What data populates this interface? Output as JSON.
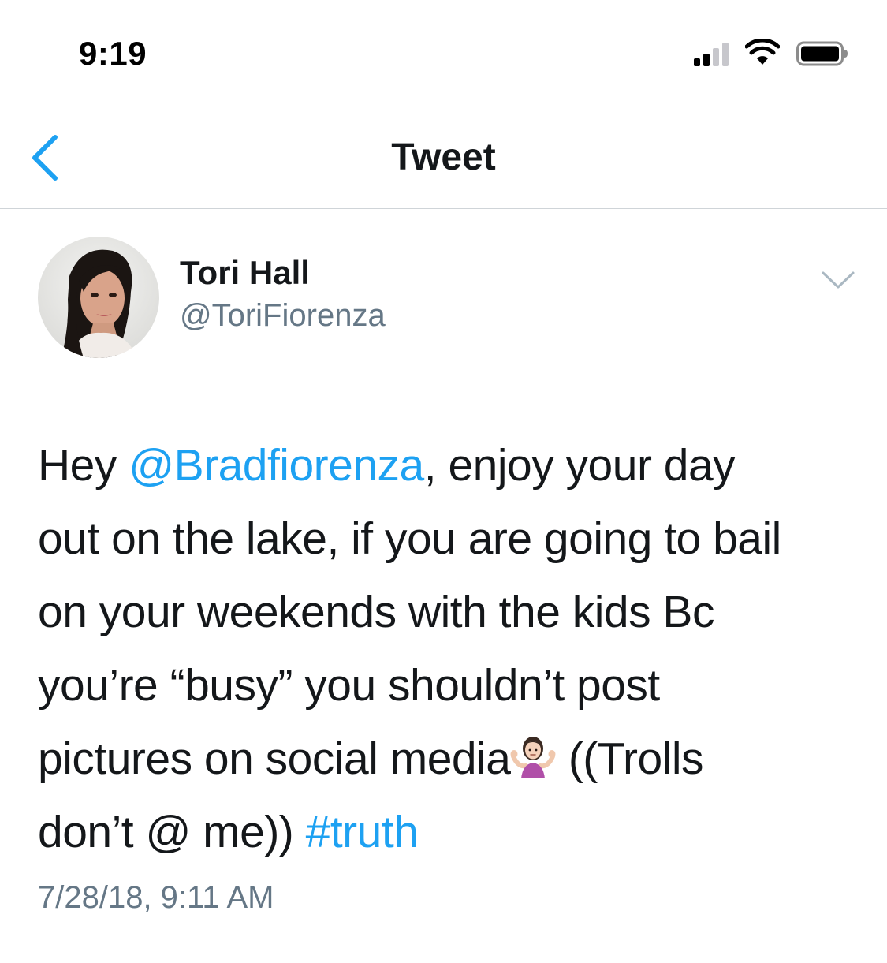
{
  "status_bar": {
    "time": "9:19",
    "signal_icon": "cellular-signal-icon",
    "wifi_icon": "wifi-icon",
    "battery_icon": "battery-icon"
  },
  "nav": {
    "title": "Tweet",
    "back_icon": "chevron-left-icon"
  },
  "tweet": {
    "author": {
      "display_name": "Tori Hall",
      "handle": "@ToriFiorenza",
      "avatar_icon": "avatar-photo"
    },
    "more_icon": "chevron-down-icon",
    "text_lines": [
      {
        "pre": "Hey ",
        "mention": "@Bradfiorenza",
        "post": ", enjoy your day"
      },
      {
        "text": "out on the lake, if you are going to bail"
      },
      {
        "text": "on your weekends with the kids  Bc"
      },
      {
        "text": "you’re “busy”  you shouldn’t post"
      },
      {
        "pre": "pictures on social media",
        "emoji": "person-shrugging-emoji",
        "post": " ((Trolls"
      },
      {
        "pre": "don’t @ me)) ",
        "hashtag": "#truth"
      }
    ],
    "timestamp": "7/28/18, 9:11 AM"
  },
  "colors": {
    "link": "#1da1f2",
    "secondary_text": "#657786",
    "primary_text": "#14171a",
    "divider": "#cfd4d8"
  }
}
